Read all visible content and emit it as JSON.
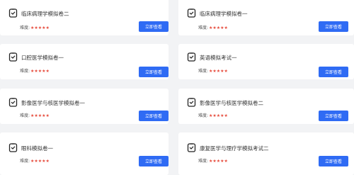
{
  "difficulty_label": "难度:",
  "view_button_label": "立即查看",
  "stars": "★★★★★",
  "colors": {
    "accent": "#2f6bf4",
    "stars": "#e64b3c",
    "page_bg": "#f2f3f5",
    "card_bg": "#ffffff"
  },
  "icon": "exam-paper-icon",
  "cards": [
    {
      "title": "临床病理学模拟卷二"
    },
    {
      "title": "临床病理学模拟卷一"
    },
    {
      "title": "口腔医学模拟卷一"
    },
    {
      "title": "英语模拟考试一"
    },
    {
      "title": "影像医学与核医学模拟卷一"
    },
    {
      "title": "影像医学与核医学模拟卷二"
    },
    {
      "title": "眼科模拟卷一"
    },
    {
      "title": "康复医学与理疗学模拟考试二"
    }
  ]
}
